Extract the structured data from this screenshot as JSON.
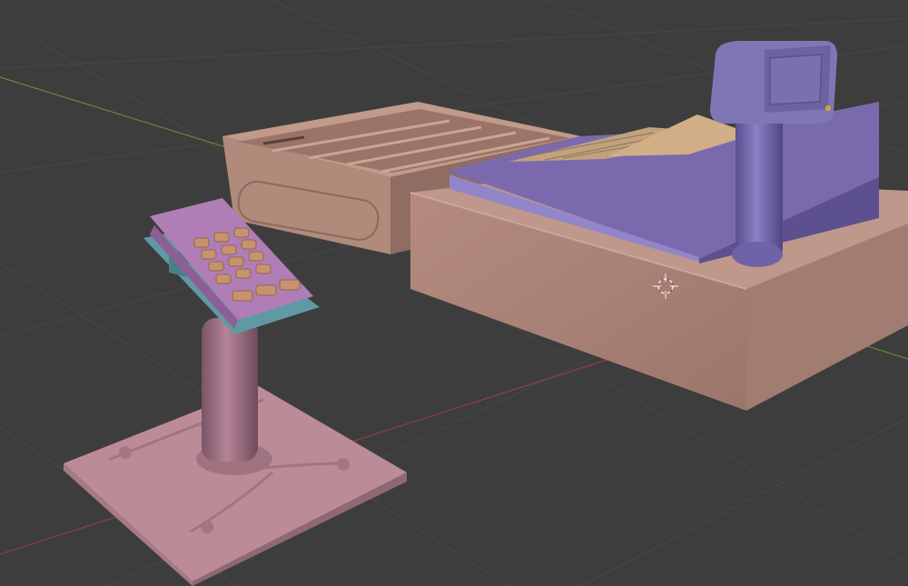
{
  "app": {
    "name": "3D Viewport",
    "mode": "solid-shading"
  },
  "scene": {
    "objects": [
      {
        "name": "card-reader-terminal",
        "color": "#b07db6"
      },
      {
        "name": "cash-drawer",
        "color": "#b08a7a"
      },
      {
        "name": "cash-register",
        "color": "#7a6aad"
      },
      {
        "name": "register-base",
        "color": "#ad8176"
      },
      {
        "name": "customer-display",
        "color": "#7f72b2"
      }
    ],
    "axis_colors": {
      "x": "#9a3c42",
      "y": "#5f8a3a"
    },
    "grid_color": "#474747",
    "background_color": "#3d3d3d",
    "cursor_icon": "3d-cursor-icon"
  }
}
